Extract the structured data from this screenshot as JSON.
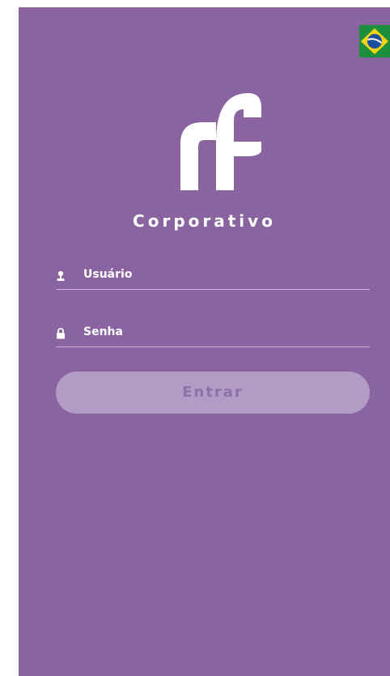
{
  "app": {
    "brand_name": "Corporativo",
    "logo_icon": "rf-logo-icon",
    "background_color": "#8964A0"
  },
  "language": {
    "flag_icon": "brazil-flag-icon"
  },
  "form": {
    "username_placeholder": "Usuário",
    "username_icon": "user-icon",
    "password_placeholder": "Senha",
    "password_icon": "lock-icon",
    "submit_label": "Entrar",
    "submit_color": "#B29CC5"
  }
}
